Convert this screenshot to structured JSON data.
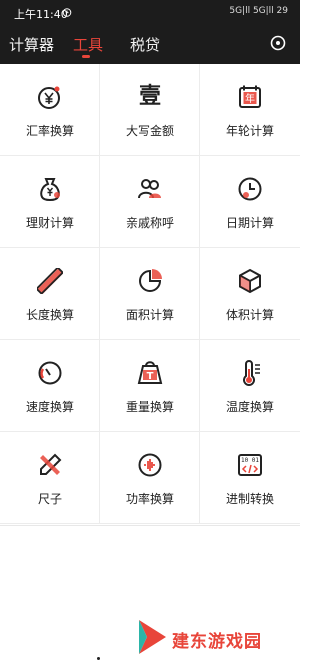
{
  "status_bar": {
    "time": "上午11:40",
    "indicators": "5G|ll 5G|ll  29"
  },
  "tabs": [
    {
      "label": "计算器",
      "active": false
    },
    {
      "label": "工具",
      "active": true
    },
    {
      "label": "税贷",
      "active": false
    }
  ],
  "colors": {
    "accent": "#e8453a",
    "header_bg": "#1c1c1c",
    "text": "#222222"
  },
  "tools": [
    {
      "label": "汇率换算",
      "icon": "currency-exchange-icon"
    },
    {
      "label": "大写金额",
      "icon": "uppercase-amount-icon",
      "glyph": "壹"
    },
    {
      "label": "年轮计算",
      "icon": "calendar-year-icon",
      "glyph": "年"
    },
    {
      "label": "理财计算",
      "icon": "money-bag-icon"
    },
    {
      "label": "亲戚称呼",
      "icon": "relatives-icon"
    },
    {
      "label": "日期计算",
      "icon": "clock-icon"
    },
    {
      "label": "长度换算",
      "icon": "ruler-icon"
    },
    {
      "label": "面积计算",
      "icon": "area-pie-icon"
    },
    {
      "label": "体积计算",
      "icon": "cube-icon"
    },
    {
      "label": "速度换算",
      "icon": "speedometer-icon"
    },
    {
      "label": "重量换算",
      "icon": "weight-icon",
      "glyph": "T"
    },
    {
      "label": "温度换算",
      "icon": "thermometer-icon"
    },
    {
      "label": "尺子",
      "icon": "pencil-ruler-icon"
    },
    {
      "label": "功率换算",
      "icon": "power-icon"
    },
    {
      "label": "进制转换",
      "icon": "code-icon",
      "glyph": "10 01"
    }
  ],
  "watermark": {
    "text": "建东游戏园"
  }
}
